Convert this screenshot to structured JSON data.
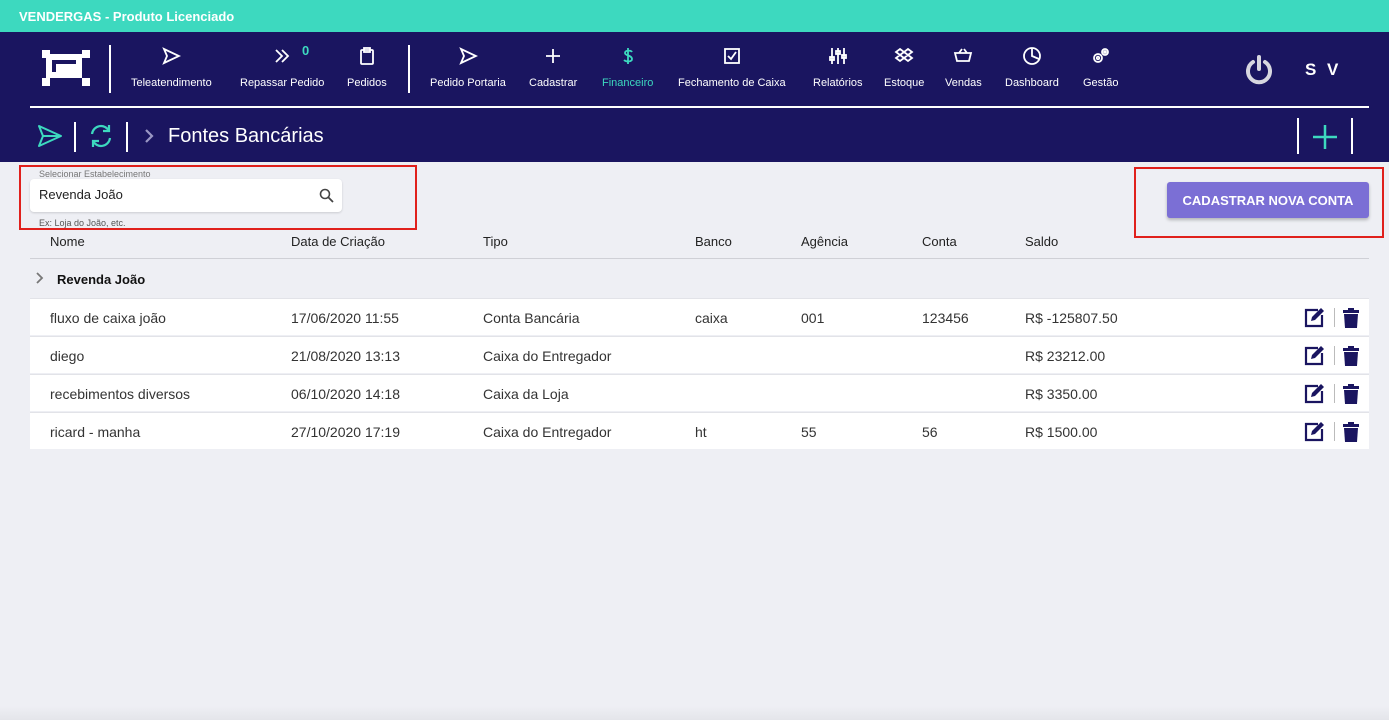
{
  "app": {
    "title": "VENDERGAS - Produto Licenciado"
  },
  "nav": {
    "items": [
      {
        "label": "Teleatendimento",
        "icon": "send-icon"
      },
      {
        "label": "Repassar Pedido",
        "icon": "double-chevron-icon",
        "badge": "0"
      },
      {
        "label": "Pedidos",
        "icon": "clipboard-icon"
      },
      {
        "label": "Pedido Portaria",
        "icon": "send-icon"
      },
      {
        "label": "Cadastrar",
        "icon": "plus-icon"
      },
      {
        "label": "Financeiro",
        "icon": "dollar-icon",
        "active": true
      },
      {
        "label": "Fechamento de Caixa",
        "icon": "checkbox-icon"
      },
      {
        "label": "Relatórios",
        "icon": "sliders-icon"
      },
      {
        "label": "Estoque",
        "icon": "dropbox-icon"
      },
      {
        "label": "Vendas",
        "icon": "basket-icon"
      },
      {
        "label": "Dashboard",
        "icon": "pie-chart-icon"
      },
      {
        "label": "Gestão",
        "icon": "gears-icon"
      }
    ],
    "user_initials": "S V"
  },
  "page": {
    "title": "Fontes Bancárias"
  },
  "filter": {
    "label": "Selecionar Estabelecimento",
    "value": "Revenda João",
    "hint": "Ex: Loja do João, etc."
  },
  "actions": {
    "new_account": "CADASTRAR NOVA CONTA"
  },
  "table": {
    "headers": [
      "Nome",
      "Data de Criação",
      "Tipo",
      "Banco",
      "Agência",
      "Conta",
      "Saldo"
    ],
    "group": "Revenda João",
    "rows": [
      [
        "fluxo de caixa joão",
        "17/06/2020 11:55",
        "Conta Bancária",
        "caixa",
        "001",
        "123456",
        "R$ -125807.50"
      ],
      [
        "diego",
        "21/08/2020 13:13",
        "Caixa do Entregador",
        "",
        "",
        "",
        "R$ 23212.00"
      ],
      [
        "recebimentos diversos",
        "06/10/2020 14:18",
        "Caixa da Loja",
        "",
        "",
        "",
        "R$ 3350.00"
      ],
      [
        "ricard - manha",
        "27/10/2020 17:19",
        "Caixa do Entregador",
        "ht",
        "55",
        "56",
        "R$ 1500.00"
      ]
    ]
  },
  "colors": {
    "navbar": "#1a1560",
    "accent": "#3dd9bf",
    "button": "#7b6fd5",
    "highlight": "#e0201c"
  }
}
